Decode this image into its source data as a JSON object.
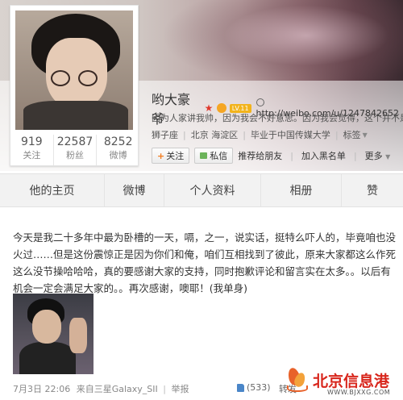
{
  "profile": {
    "name": "哟大豪爷",
    "badge_lv": "LV.11",
    "url": "http://weibo.com/u/1247842652",
    "bio": "因为人家讲我帅，因为我会不好意思。因为我会觉得，这个并不是拿我努力",
    "tags": [
      "狮子座",
      "北京 海淀区",
      "毕业于中国传媒大学",
      "标签"
    ],
    "stats": [
      {
        "num": "919",
        "label": "关注"
      },
      {
        "num": "22587",
        "label": "粉丝"
      },
      {
        "num": "8252",
        "label": "微博"
      }
    ]
  },
  "actions": {
    "follow": "关注",
    "message": "私信",
    "recommend": "推荐给朋友",
    "blacklist": "加入黑名单",
    "more": "更多"
  },
  "tabs": [
    "他的主页",
    "微博",
    "个人资料",
    "相册",
    "赞"
  ],
  "post": {
    "text": "今天是我二十多年中最为卧槽的一天，嗝，之一，说实话，挺特么吓人的，毕竟咱也没火过……但是这份震惊正是因为你们和俺，咱们互相找到了彼此，原来大家都这么作死这么没节操哈哈哈，真的要感谢大家的支持，同时抱歉评论和留言实在太多。。以后有机会一定会满足大家的。。再次感谢，噢耶！(我单身)",
    "date": "7月3日 22:06",
    "source": "来自三星Galaxy_SII",
    "report": "举报",
    "likes": "(533)",
    "repost": "转发"
  },
  "watermark": {
    "title": "北京信息港",
    "url": "WWW.BJXXG.COM"
  }
}
